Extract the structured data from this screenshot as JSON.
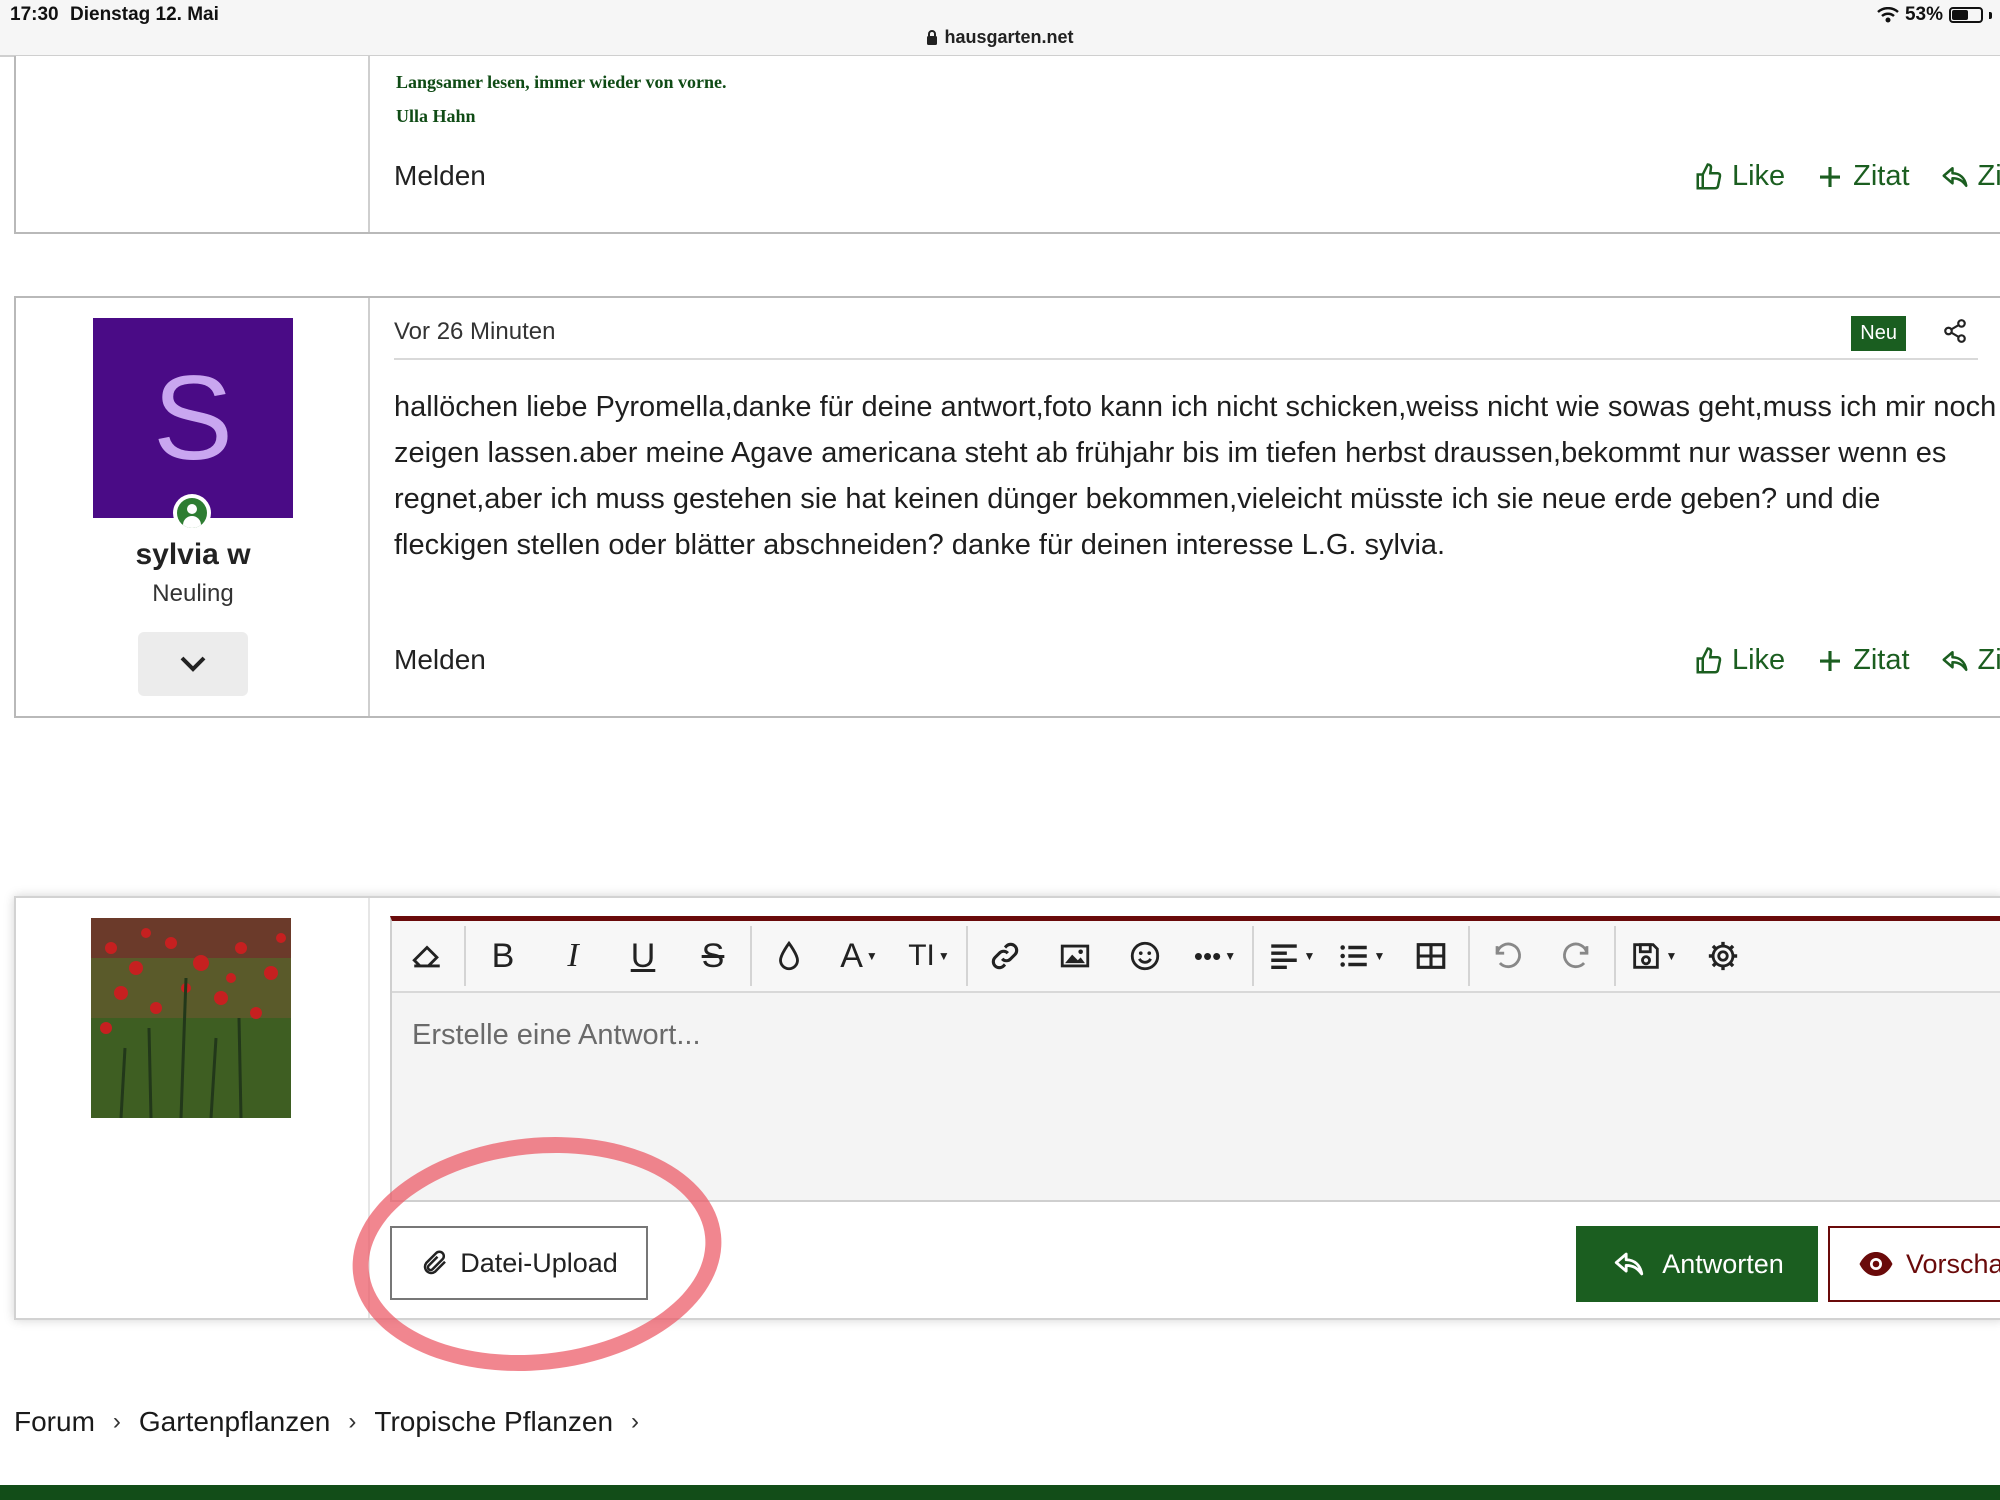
{
  "status_bar": {
    "time": "17:30",
    "date": "Dienstag 12. Mai",
    "battery": "53%",
    "battery_level": 0.53,
    "url": "hausgarten.net"
  },
  "post_top": {
    "signature_line1": "Langsamer lesen, immer wieder von vorne.",
    "signature_line2": "Ulla Hahn",
    "report_label": "Melden",
    "actions": {
      "like": "Like",
      "quote": "Zitat",
      "cite": "Zitier"
    }
  },
  "post_main": {
    "avatar_letter": "S",
    "username": "sylvia w",
    "role": "Neuling",
    "time": "Vor 26 Minuten",
    "badge": "Neu",
    "message": "hallöchen liebe Pyromella,danke für deine antwort,foto kann ich nicht schicken,weiss nicht wie sowas geht,muss ich mir noch zeigen lassen.aber meine Agave americana steht ab frühjahr bis im tiefen herbst draussen,bekommt nur wasser wenn es regnet,aber ich muss gestehen sie hat keinen dünger bekommen,vieleicht müsste ich sie neue erde geben? und die fleckigen stellen oder blätter abschneiden? danke für deinen interesse L.G. sylvia.",
    "report_label": "Melden",
    "actions": {
      "like": "Like",
      "quote": "Zitat",
      "cite": "Zitier"
    }
  },
  "reply": {
    "placeholder": "Erstelle eine Antwort...",
    "toolbar_icons": [
      "eraser-icon",
      "bold-icon",
      "italic-icon",
      "underline-icon",
      "strikethrough-icon",
      "color-drop-icon",
      "font-family-icon",
      "font-size-icon",
      "link-icon",
      "image-icon",
      "emoji-icon",
      "more-icon",
      "align-icon",
      "list-icon",
      "table-icon",
      "undo-icon",
      "redo-icon",
      "save-icon",
      "settings-icon"
    ],
    "toolbar_glyphs": {
      "bold": "B",
      "italic": "I",
      "underline": "U",
      "strike": "S",
      "font": "A",
      "size": "TI"
    },
    "upload_label": "Datei-Upload",
    "submit_label": "Antworten",
    "preview_label": "Vorschau"
  },
  "breadcrumb": [
    "Forum",
    "Gartenpflanzen",
    "Tropische Pflanzen"
  ],
  "colors": {
    "accent_green": "#1b5e20",
    "accent_red": "#6a0a0a",
    "avatar_purple": "#4a0b86",
    "annotation": "#ec5864"
  }
}
